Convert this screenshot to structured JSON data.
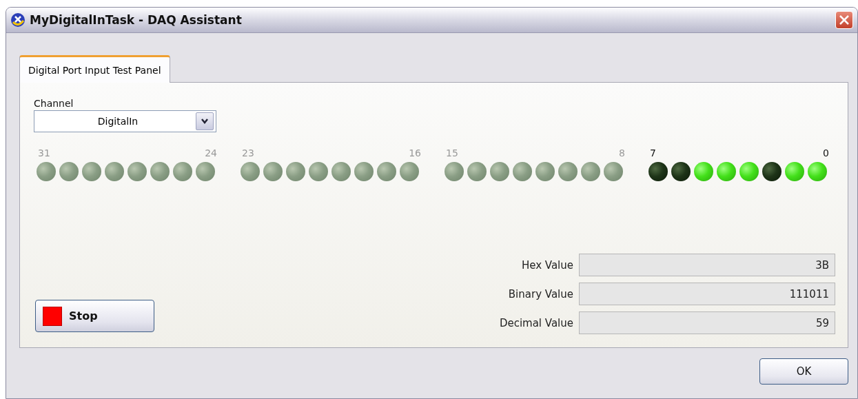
{
  "window": {
    "title": "MyDigitalInTask - DAQ Assistant"
  },
  "tabs": [
    {
      "label": "Digital Port Input Test Panel",
      "selected": true
    }
  ],
  "channel": {
    "label": "Channel",
    "value": "DigitalIn"
  },
  "ports": [
    {
      "high_label": "31",
      "low_label": "24",
      "enabled": false,
      "leds": [
        {
          "on": false
        },
        {
          "on": false
        },
        {
          "on": false
        },
        {
          "on": false
        },
        {
          "on": false
        },
        {
          "on": false
        },
        {
          "on": false
        },
        {
          "on": false
        }
      ]
    },
    {
      "high_label": "23",
      "low_label": "16",
      "enabled": false,
      "leds": [
        {
          "on": false
        },
        {
          "on": false
        },
        {
          "on": false
        },
        {
          "on": false
        },
        {
          "on": false
        },
        {
          "on": false
        },
        {
          "on": false
        },
        {
          "on": false
        }
      ]
    },
    {
      "high_label": "15",
      "low_label": "8",
      "enabled": false,
      "leds": [
        {
          "on": false
        },
        {
          "on": false
        },
        {
          "on": false
        },
        {
          "on": false
        },
        {
          "on": false
        },
        {
          "on": false
        },
        {
          "on": false
        },
        {
          "on": false
        }
      ]
    },
    {
      "high_label": "7",
      "low_label": "0",
      "enabled": true,
      "leds": [
        {
          "on": false
        },
        {
          "on": false
        },
        {
          "on": true
        },
        {
          "on": true
        },
        {
          "on": true
        },
        {
          "on": false
        },
        {
          "on": true
        },
        {
          "on": true
        }
      ]
    }
  ],
  "values": [
    {
      "label": "Hex Value",
      "value": "3B"
    },
    {
      "label": "Binary Value",
      "value": "111011"
    },
    {
      "label": "Decimal Value",
      "value": "59"
    }
  ],
  "stop_button": {
    "label": "Stop"
  },
  "ok_button": {
    "label": "OK"
  }
}
